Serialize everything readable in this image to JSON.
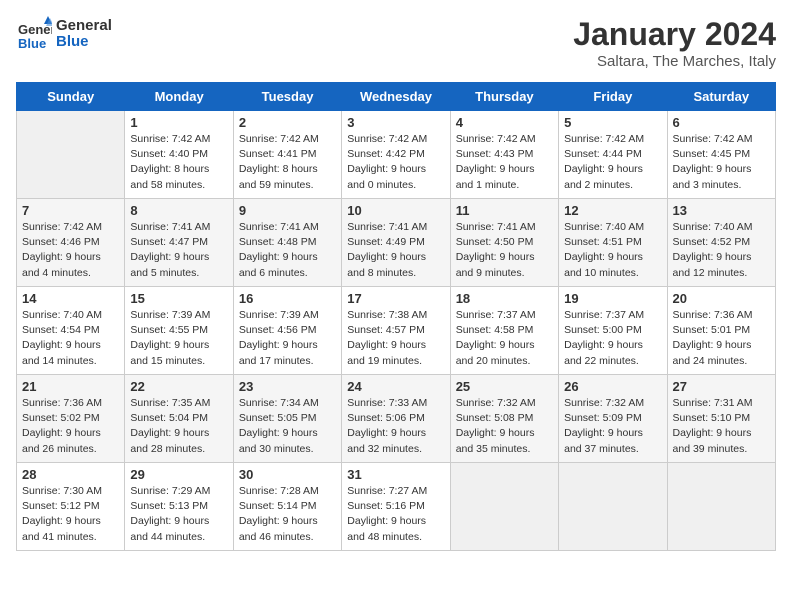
{
  "header": {
    "logo_line1": "General",
    "logo_line2": "Blue",
    "title": "January 2024",
    "subtitle": "Saltara, The Marches, Italy"
  },
  "columns": [
    "Sunday",
    "Monday",
    "Tuesday",
    "Wednesday",
    "Thursday",
    "Friday",
    "Saturday"
  ],
  "weeks": [
    [
      {
        "day": "",
        "empty": true
      },
      {
        "day": "1",
        "sunrise": "7:42 AM",
        "sunset": "4:40 PM",
        "daylight": "8 hours and 58 minutes."
      },
      {
        "day": "2",
        "sunrise": "7:42 AM",
        "sunset": "4:41 PM",
        "daylight": "8 hours and 59 minutes."
      },
      {
        "day": "3",
        "sunrise": "7:42 AM",
        "sunset": "4:42 PM",
        "daylight": "9 hours and 0 minutes."
      },
      {
        "day": "4",
        "sunrise": "7:42 AM",
        "sunset": "4:43 PM",
        "daylight": "9 hours and 1 minute."
      },
      {
        "day": "5",
        "sunrise": "7:42 AM",
        "sunset": "4:44 PM",
        "daylight": "9 hours and 2 minutes."
      },
      {
        "day": "6",
        "sunrise": "7:42 AM",
        "sunset": "4:45 PM",
        "daylight": "9 hours and 3 minutes."
      }
    ],
    [
      {
        "day": "7",
        "sunrise": "7:42 AM",
        "sunset": "4:46 PM",
        "daylight": "9 hours and 4 minutes."
      },
      {
        "day": "8",
        "sunrise": "7:41 AM",
        "sunset": "4:47 PM",
        "daylight": "9 hours and 5 minutes."
      },
      {
        "day": "9",
        "sunrise": "7:41 AM",
        "sunset": "4:48 PM",
        "daylight": "9 hours and 6 minutes."
      },
      {
        "day": "10",
        "sunrise": "7:41 AM",
        "sunset": "4:49 PM",
        "daylight": "9 hours and 8 minutes."
      },
      {
        "day": "11",
        "sunrise": "7:41 AM",
        "sunset": "4:50 PM",
        "daylight": "9 hours and 9 minutes."
      },
      {
        "day": "12",
        "sunrise": "7:40 AM",
        "sunset": "4:51 PM",
        "daylight": "9 hours and 10 minutes."
      },
      {
        "day": "13",
        "sunrise": "7:40 AM",
        "sunset": "4:52 PM",
        "daylight": "9 hours and 12 minutes."
      }
    ],
    [
      {
        "day": "14",
        "sunrise": "7:40 AM",
        "sunset": "4:54 PM",
        "daylight": "9 hours and 14 minutes."
      },
      {
        "day": "15",
        "sunrise": "7:39 AM",
        "sunset": "4:55 PM",
        "daylight": "9 hours and 15 minutes."
      },
      {
        "day": "16",
        "sunrise": "7:39 AM",
        "sunset": "4:56 PM",
        "daylight": "9 hours and 17 minutes."
      },
      {
        "day": "17",
        "sunrise": "7:38 AM",
        "sunset": "4:57 PM",
        "daylight": "9 hours and 19 minutes."
      },
      {
        "day": "18",
        "sunrise": "7:37 AM",
        "sunset": "4:58 PM",
        "daylight": "9 hours and 20 minutes."
      },
      {
        "day": "19",
        "sunrise": "7:37 AM",
        "sunset": "5:00 PM",
        "daylight": "9 hours and 22 minutes."
      },
      {
        "day": "20",
        "sunrise": "7:36 AM",
        "sunset": "5:01 PM",
        "daylight": "9 hours and 24 minutes."
      }
    ],
    [
      {
        "day": "21",
        "sunrise": "7:36 AM",
        "sunset": "5:02 PM",
        "daylight": "9 hours and 26 minutes."
      },
      {
        "day": "22",
        "sunrise": "7:35 AM",
        "sunset": "5:04 PM",
        "daylight": "9 hours and 28 minutes."
      },
      {
        "day": "23",
        "sunrise": "7:34 AM",
        "sunset": "5:05 PM",
        "daylight": "9 hours and 30 minutes."
      },
      {
        "day": "24",
        "sunrise": "7:33 AM",
        "sunset": "5:06 PM",
        "daylight": "9 hours and 32 minutes."
      },
      {
        "day": "25",
        "sunrise": "7:32 AM",
        "sunset": "5:08 PM",
        "daylight": "9 hours and 35 minutes."
      },
      {
        "day": "26",
        "sunrise": "7:32 AM",
        "sunset": "5:09 PM",
        "daylight": "9 hours and 37 minutes."
      },
      {
        "day": "27",
        "sunrise": "7:31 AM",
        "sunset": "5:10 PM",
        "daylight": "9 hours and 39 minutes."
      }
    ],
    [
      {
        "day": "28",
        "sunrise": "7:30 AM",
        "sunset": "5:12 PM",
        "daylight": "9 hours and 41 minutes."
      },
      {
        "day": "29",
        "sunrise": "7:29 AM",
        "sunset": "5:13 PM",
        "daylight": "9 hours and 44 minutes."
      },
      {
        "day": "30",
        "sunrise": "7:28 AM",
        "sunset": "5:14 PM",
        "daylight": "9 hours and 46 minutes."
      },
      {
        "day": "31",
        "sunrise": "7:27 AM",
        "sunset": "5:16 PM",
        "daylight": "9 hours and 48 minutes."
      },
      {
        "day": "",
        "empty": true
      },
      {
        "day": "",
        "empty": true
      },
      {
        "day": "",
        "empty": true
      }
    ]
  ],
  "labels": {
    "sunrise_prefix": "Sunrise: ",
    "sunset_prefix": "Sunset: ",
    "daylight_prefix": "Daylight: "
  }
}
